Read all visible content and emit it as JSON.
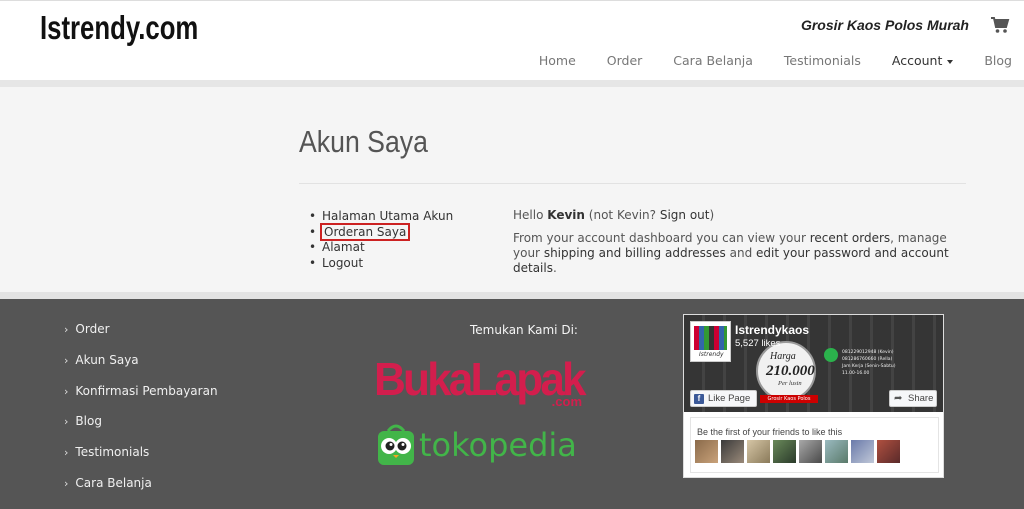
{
  "site": {
    "logo": "Istrendy.com",
    "tagline": "Grosir Kaos Polos Murah"
  },
  "nav": {
    "items": [
      "Home",
      "Order",
      "Cara Belanja",
      "Testimonials",
      "Account",
      "Blog"
    ]
  },
  "page": {
    "title": "Akun Saya"
  },
  "account_menu": {
    "items": [
      "Halaman Utama Akun",
      "Orderan Saya",
      "Alamat",
      "Logout"
    ],
    "active_index": 1
  },
  "dashboard": {
    "hello": "Hello",
    "username": "Kevin",
    "not_prefix": "(not Kevin?",
    "sign_out": "Sign out",
    "not_suffix": ")",
    "intro": "From your account dashboard you can view your",
    "recent_orders": "recent orders",
    "manage": ", manage your",
    "shipping_billing": "shipping and billing addresses",
    "and_edit": "and",
    "edit_password": "edit your password and account details",
    "period": "."
  },
  "footer": {
    "links": [
      "Order",
      "Akun Saya",
      "Konfirmasi Pembayaran",
      "Blog",
      "Testimonials",
      "Cara Belanja"
    ],
    "find_us": "Temukan Kami Di:",
    "bukalapak": "BukaLapak",
    "bukalapak_domain": ".com",
    "tokopedia": "tokopedia"
  },
  "facebook_widget": {
    "page_name": "Istrendykaos",
    "likes": "5,527 likes",
    "promo_harga": "Harga",
    "promo_price": "210.000",
    "promo_per": "Per lusin",
    "promo_ribbon": "Grosir Kaos Polos",
    "contact_line1": "081229012948 (Kevin)",
    "contact_line2": "081286760660 (Rella)",
    "contact_line3": "Jam Kerja (Senin-Sabtu)",
    "contact_line4": "11.00-16.00",
    "thumb_label": "Istrendy",
    "like_button": "Like Page",
    "share_button": "Share",
    "friends_text": "Be the first of your friends to like this",
    "friend_count": 8
  },
  "colors": {
    "footer_bg": "#555555",
    "content_bg": "#f5f5f5",
    "bukalapak": "#d31e4d",
    "tokopedia": "#42b549",
    "facebook": "#3b5998",
    "highlight_border": "#cc2222"
  }
}
